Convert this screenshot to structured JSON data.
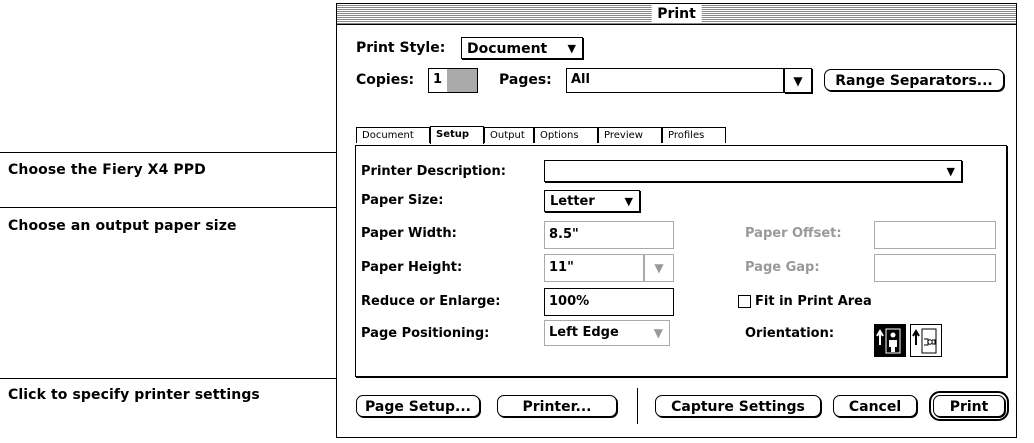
{
  "callouts": {
    "ppd": "Choose the Fiery X4 PPD",
    "paper": "Choose an output paper size",
    "printer": "Click to specify printer settings"
  },
  "window": {
    "title": "Print"
  },
  "print_style": {
    "label": "Print Style:",
    "value": "Document"
  },
  "copies": {
    "label": "Copies:",
    "value": "1"
  },
  "pages": {
    "label": "Pages:",
    "value": "All"
  },
  "range_separators": "Range Separators...",
  "tabs": [
    "Document",
    "Setup",
    "Output",
    "Options",
    "Preview",
    "Profiles"
  ],
  "active_tab": "Setup",
  "setup": {
    "printer_description_label": "Printer Description:",
    "printer_description_value": "",
    "paper_size_label": "Paper Size:",
    "paper_size_value": "Letter",
    "paper_width_label": "Paper Width:",
    "paper_width_value": "8.5\"",
    "paper_height_label": "Paper Height:",
    "paper_height_value": "11\"",
    "reduce_label": "Reduce or Enlarge:",
    "reduce_value": "100%",
    "positioning_label": "Page Positioning:",
    "positioning_value": "Left Edge",
    "paper_offset_label": "Paper Offset:",
    "page_gap_label": "Page Gap:",
    "fit_label": "Fit in Print Area",
    "orientation_label": "Orientation:"
  },
  "buttons": {
    "page_setup": "Page Setup...",
    "printer": "Printer...",
    "capture": "Capture Settings",
    "cancel": "Cancel",
    "print": "Print"
  }
}
